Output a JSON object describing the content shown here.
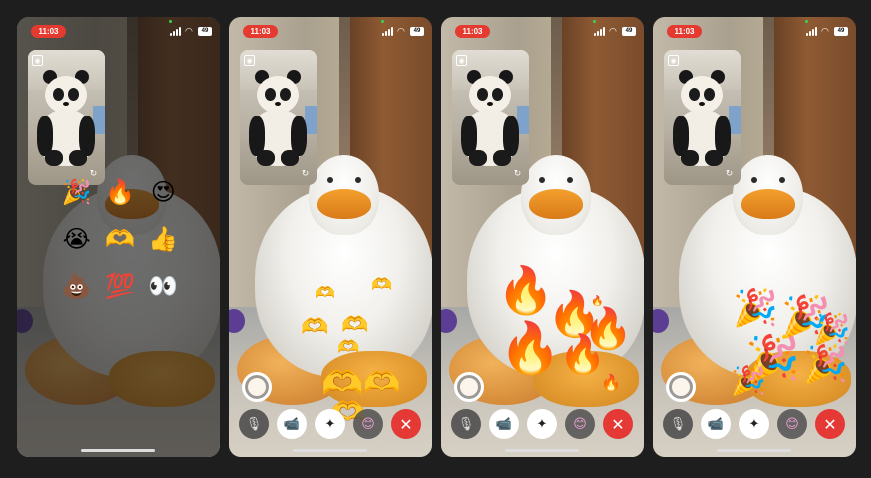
{
  "status_bar": {
    "time": "11:03",
    "battery": "49"
  },
  "picker": {
    "emojis": [
      {
        "glyph": "🎉",
        "name": "party"
      },
      {
        "glyph": "🔥",
        "name": "fire"
      },
      {
        "glyph": "😍",
        "name": "heart-eyes"
      },
      {
        "glyph": "😭",
        "name": "crying"
      },
      {
        "glyph": "🫶",
        "name": "heart-hands"
      },
      {
        "glyph": "👍",
        "name": "thumbs-up"
      },
      {
        "glyph": "💩",
        "name": "poop"
      },
      {
        "glyph": "💯",
        "name": "hundred"
      },
      {
        "glyph": "👀",
        "name": "eyes"
      }
    ]
  },
  "effects": {
    "heart_hands": "🫶",
    "fire": "🔥",
    "party": "🎉"
  },
  "controls": {
    "mic": "🎙",
    "camera": "📹",
    "effects": "✦",
    "emoji": "😊",
    "end": "✕"
  },
  "icons": {
    "self_view_person": "person-icon",
    "flip_camera": "↻",
    "wifi": "wifi-icon",
    "signal": "signal-icon"
  },
  "colors": {
    "end_call": "#e53935",
    "time_pill": "#e53a2f",
    "background": "#1e1e1e"
  }
}
